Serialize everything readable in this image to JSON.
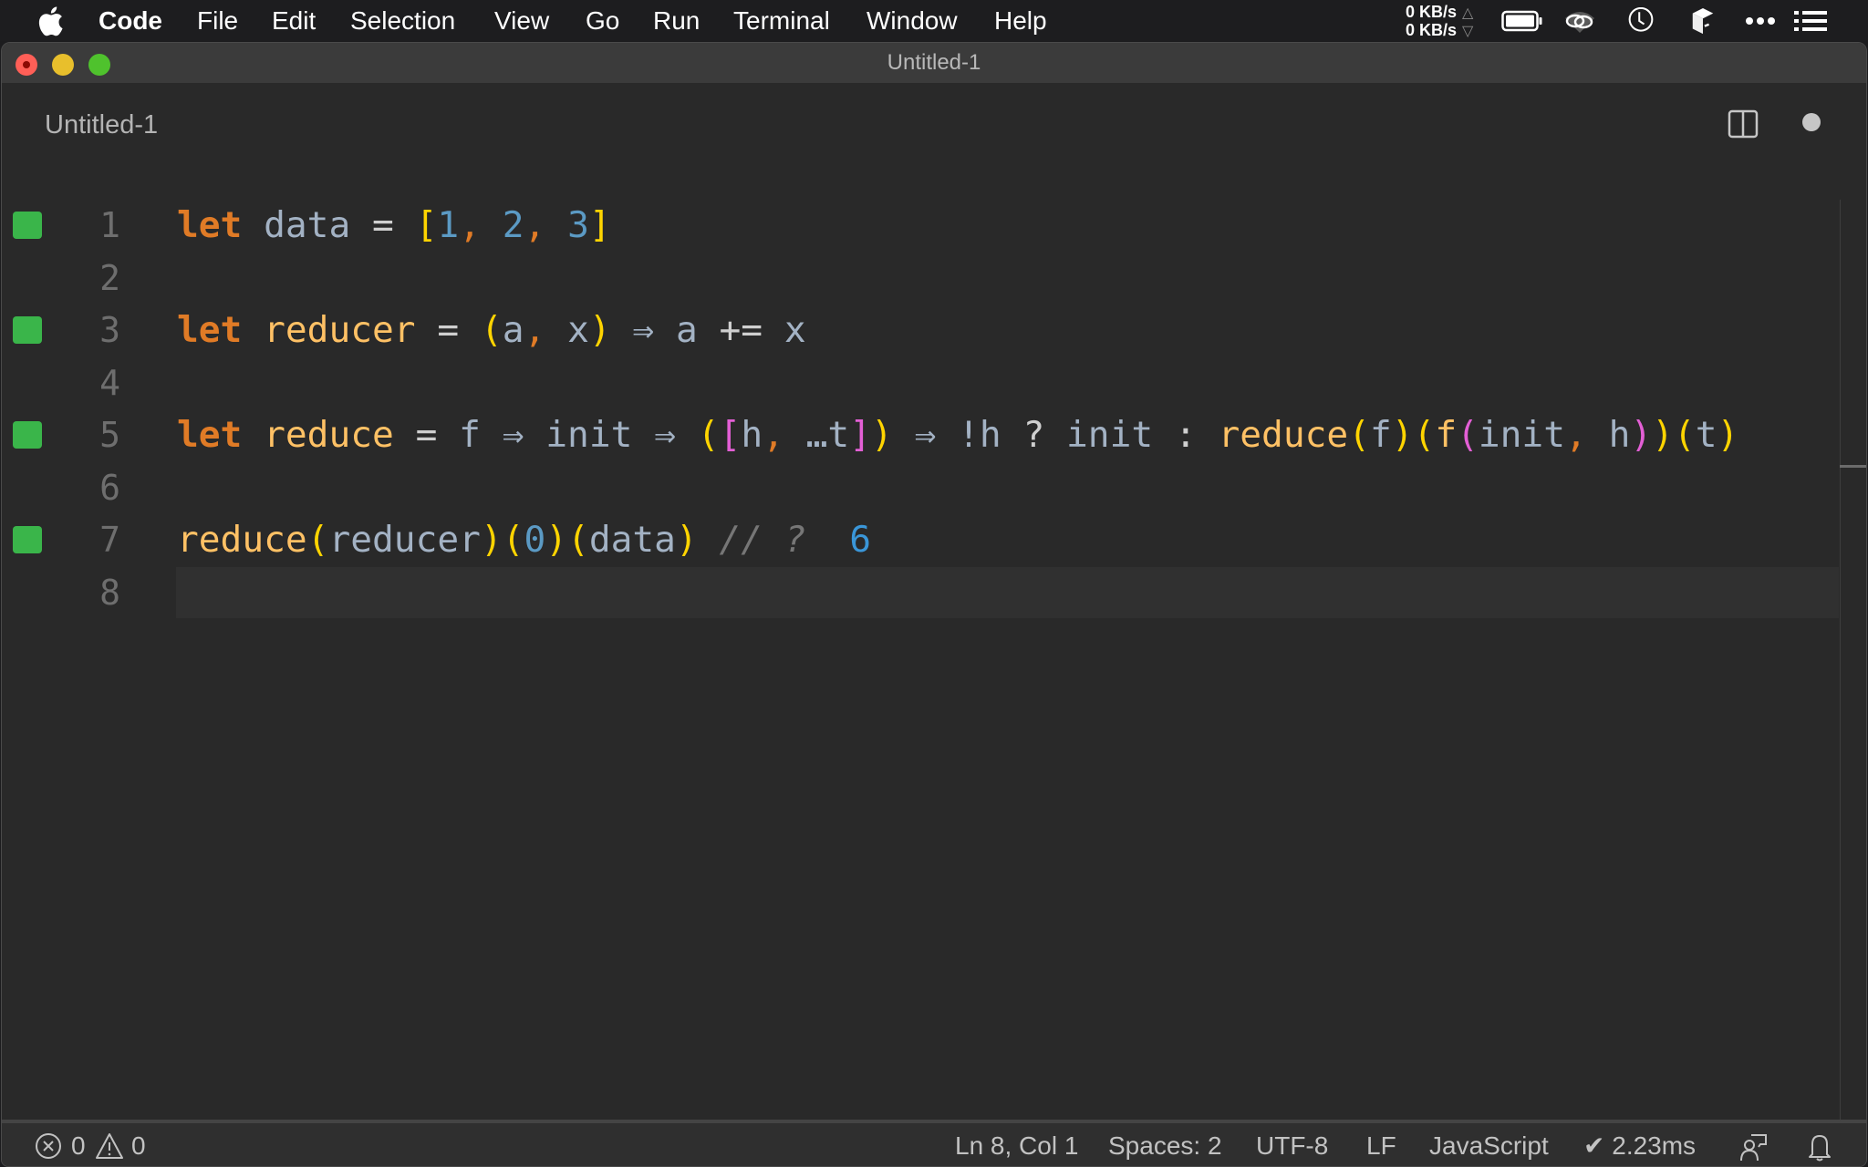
{
  "menubar": {
    "app_name": "Code",
    "items": [
      "File",
      "Edit",
      "Selection",
      "View",
      "Go",
      "Run",
      "Terminal",
      "Window",
      "Help"
    ],
    "network": {
      "upload": "0 KB/s",
      "download": "0 KB/s"
    },
    "tray_icons": [
      "battery-icon",
      "creative-cloud-icon",
      "clock-icon",
      "cube-icon",
      "more-icon",
      "list-icon"
    ]
  },
  "window": {
    "title": "Untitled-1",
    "tab": {
      "label": "Untitled-1",
      "dirty": true
    }
  },
  "editor": {
    "lines": [
      {
        "number": "1",
        "marker": true,
        "text": "let data = [1, 2, 3]"
      },
      {
        "number": "2",
        "marker": false,
        "text": ""
      },
      {
        "number": "3",
        "marker": true,
        "text": "let reducer = (a, x) ⇒ a += x"
      },
      {
        "number": "4",
        "marker": false,
        "text": ""
      },
      {
        "number": "5",
        "marker": true,
        "text": "let reduce = f ⇒ init ⇒ ([h, …t]) ⇒ !h ? init : reduce(f)(f(init, h))(t)"
      },
      {
        "number": "6",
        "marker": false,
        "text": ""
      },
      {
        "number": "7",
        "marker": true,
        "text": "reduce(reducer)(0)(data) // ?",
        "inline_result": "6"
      },
      {
        "number": "8",
        "marker": false,
        "text": "",
        "current": true
      }
    ],
    "marker_color": "#3ab54a"
  },
  "statusbar": {
    "errors": "0",
    "warnings": "0",
    "cursor": "Ln 8, Col 1",
    "indent": "Spaces: 2",
    "encoding": "UTF-8",
    "eol": "LF",
    "language": "JavaScript",
    "timing": "✔ 2.23ms"
  }
}
